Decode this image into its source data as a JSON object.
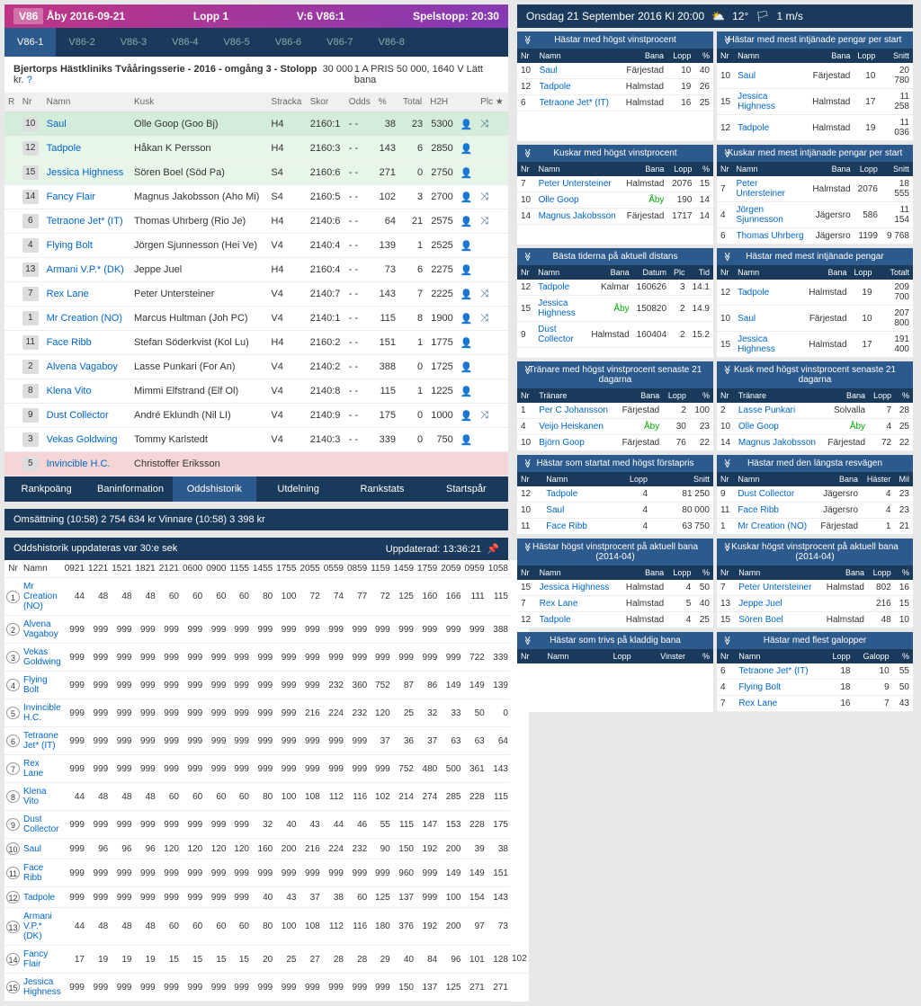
{
  "header": {
    "badge": "V86",
    "track": "Åby 2016-09-21",
    "race": "Lopp 1",
    "leg": "V:6 V86:1",
    "stop": "Spelstopp: 20:30"
  },
  "tabs": [
    "V86-1",
    "V86-2",
    "V86-3",
    "V86-4",
    "V86-5",
    "V86-6",
    "V86-7",
    "V86-8"
  ],
  "raceInfo": {
    "title": "Bjertorps Hästkliniks Tvååringsserie - 2016 - omgång 3 - Stolopp",
    "prize": "30 000 kr.",
    "cond": "1 A PRIS 50 000, 1640 V Lätt bana"
  },
  "mainCols": [
    "R",
    "Nr",
    "Namn",
    "Kusk",
    "Stracka",
    "Skor",
    "Odds",
    "%",
    "Total",
    "H2H",
    "",
    "Plc"
  ],
  "horses": [
    {
      "nr": "10",
      "name": "Saul",
      "kusk": "Olle Goop (Goo Bj)",
      "dist": "H4",
      "str": "2160:1",
      "sk": "- -",
      "odds": "38",
      "pct": "23",
      "tot": "5300",
      "ico": "👤",
      "x": "⤨",
      "hl": "hl-green"
    },
    {
      "nr": "12",
      "name": "Tadpole",
      "kusk": "Håkan K Persson",
      "dist": "H4",
      "str": "2160:3",
      "sk": "- -",
      "odds": "143",
      "pct": "6",
      "tot": "2850",
      "ico": "👤",
      "x": "",
      "hl": "hl-lgreen"
    },
    {
      "nr": "15",
      "name": "Jessica Highness",
      "kusk": "Sören Boel (Söd Pa)",
      "dist": "S4",
      "str": "2160:6",
      "sk": "- -",
      "odds": "271",
      "pct": "0",
      "tot": "2750",
      "ico": "👤",
      "x": "",
      "hl": "hl-lgreen"
    },
    {
      "nr": "14",
      "name": "Fancy Flair",
      "kusk": "Magnus Jakobsson (Aho Mi)",
      "dist": "S4",
      "str": "2160:5",
      "sk": "- -",
      "odds": "102",
      "pct": "3",
      "tot": "2700",
      "ico": "👤",
      "x": "⤨",
      "hl": ""
    },
    {
      "nr": "6",
      "name": "Tetraone Jet* (IT)",
      "kusk": "Thomas Uhrberg (Rio Je)",
      "dist": "H4",
      "str": "2140:6",
      "sk": "- -",
      "odds": "64",
      "pct": "21",
      "tot": "2575",
      "ico": "👤",
      "x": "⤨",
      "hl": ""
    },
    {
      "nr": "4",
      "name": "Flying Bolt",
      "kusk": "Jörgen Sjunnesson (Hei Ve)",
      "dist": "V4",
      "str": "2140:4",
      "sk": "- -",
      "odds": "139",
      "pct": "1",
      "tot": "2525",
      "ico": "👤",
      "x": "",
      "hl": ""
    },
    {
      "nr": "13",
      "name": "Armani V.P.* (DK)",
      "kusk": "Jeppe Juel",
      "dist": "H4",
      "str": "2160:4",
      "sk": "- -",
      "odds": "73",
      "pct": "6",
      "tot": "2275",
      "ico": "👤",
      "x": "",
      "hl": ""
    },
    {
      "nr": "7",
      "name": "Rex Lane",
      "kusk": "Peter Untersteiner",
      "dist": "V4",
      "str": "2140:7",
      "sk": "- -",
      "odds": "143",
      "pct": "7",
      "tot": "2225",
      "ico": "👤",
      "x": "⤨",
      "hl": ""
    },
    {
      "nr": "1",
      "name": "Mr Creation (NO)",
      "kusk": "Marcus Hultman (Joh PC)",
      "dist": "V4",
      "str": "2140:1",
      "sk": "- -",
      "odds": "115",
      "pct": "8",
      "tot": "1900",
      "ico": "👤",
      "x": "⤨",
      "hl": ""
    },
    {
      "nr": "11",
      "name": "Face Ribb",
      "kusk": "Stefan Söderkvist (Kol Lu)",
      "dist": "H4",
      "str": "2160:2",
      "sk": "- -",
      "odds": "151",
      "pct": "1",
      "tot": "1775",
      "ico": "👤",
      "x": "",
      "hl": ""
    },
    {
      "nr": "2",
      "name": "Alvena Vagaboy",
      "kusk": "Lasse Punkari (For An)",
      "dist": "V4",
      "str": "2140:2",
      "sk": "- -",
      "odds": "388",
      "pct": "0",
      "tot": "1725",
      "ico": "👤",
      "x": "",
      "hl": ""
    },
    {
      "nr": "8",
      "name": "Klena Vito",
      "kusk": "Mimmi Elfstrand (Elf Ol)",
      "dist": "V4",
      "str": "2140:8",
      "sk": "- -",
      "odds": "115",
      "pct": "1",
      "tot": "1225",
      "ico": "👤",
      "x": "",
      "hl": ""
    },
    {
      "nr": "9",
      "name": "Dust Collector",
      "kusk": "André Eklundh (Nil LI)",
      "dist": "V4",
      "str": "2140:9",
      "sk": "- -",
      "odds": "175",
      "pct": "0",
      "tot": "1000",
      "ico": "👤",
      "x": "⤨",
      "hl": ""
    },
    {
      "nr": "3",
      "name": "Vekas Goldwing",
      "kusk": "Tommy Karlstedt",
      "dist": "V4",
      "str": "2140:3",
      "sk": "- -",
      "odds": "339",
      "pct": "0",
      "tot": "750",
      "ico": "👤",
      "x": "",
      "hl": ""
    },
    {
      "nr": "5",
      "name": "Invincible H.C.",
      "kusk": "Christoffer Eriksson",
      "dist": "",
      "str": "",
      "sk": "",
      "odds": "",
      "pct": "",
      "tot": "",
      "ico": "",
      "x": "",
      "hl": "hl-pink"
    }
  ],
  "btns": [
    "Rankpoäng",
    "Baninformation",
    "Oddshistorik",
    "Utdelning",
    "Rankstats",
    "Startspår"
  ],
  "turnover": "Omsättning (10:58)   2 754 634 kr    Vinnare (10:58)   3 398 kr",
  "oddsHdr": {
    "l": "Oddshistorik uppdateras var 30:e sek",
    "r": "Uppdaterad: 13:36:21"
  },
  "oddsCols": [
    "Nr",
    "Namn",
    "0921",
    "1221",
    "1521",
    "1821",
    "2121",
    "0600",
    "0900",
    "1155",
    "1455",
    "1755",
    "2055",
    "0559",
    "0859",
    "1159",
    "1459",
    "1759",
    "2059",
    "0959",
    "1058"
  ],
  "odds": [
    {
      "nr": "1",
      "n": "Mr Creation (NO)",
      "v": [
        "44",
        "48",
        "48",
        "48",
        "60",
        "60",
        "60",
        "60",
        "80",
        "100",
        "72",
        "74",
        "77",
        "72",
        "125",
        "160",
        "166",
        "111",
        "115"
      ]
    },
    {
      "nr": "2",
      "n": "Alvena Vagaboy",
      "v": [
        "999",
        "999",
        "999",
        "999",
        "999",
        "999",
        "999",
        "999",
        "999",
        "999",
        "999",
        "999",
        "999",
        "999",
        "999",
        "999",
        "999",
        "999",
        "388"
      ]
    },
    {
      "nr": "3",
      "n": "Vekas Goldwing",
      "v": [
        "999",
        "999",
        "999",
        "999",
        "999",
        "999",
        "999",
        "999",
        "999",
        "999",
        "999",
        "999",
        "999",
        "999",
        "999",
        "999",
        "999",
        "722",
        "339"
      ]
    },
    {
      "nr": "4",
      "n": "Flying Bolt",
      "v": [
        "999",
        "999",
        "999",
        "999",
        "999",
        "999",
        "999",
        "999",
        "999",
        "999",
        "999",
        "232",
        "360",
        "752",
        "87",
        "86",
        "149",
        "149",
        "139"
      ]
    },
    {
      "nr": "5",
      "n": "Invincible H.C.",
      "v": [
        "999",
        "999",
        "999",
        "999",
        "999",
        "999",
        "999",
        "999",
        "999",
        "999",
        "216",
        "224",
        "232",
        "120",
        "25",
        "32",
        "33",
        "50",
        "0"
      ]
    },
    {
      "nr": "6",
      "n": "Tetraone Jet* (IT)",
      "v": [
        "999",
        "999",
        "999",
        "999",
        "999",
        "999",
        "999",
        "999",
        "999",
        "999",
        "999",
        "999",
        "999",
        "37",
        "36",
        "37",
        "63",
        "63",
        "64"
      ]
    },
    {
      "nr": "7",
      "n": "Rex Lane",
      "v": [
        "999",
        "999",
        "999",
        "999",
        "999",
        "999",
        "999",
        "999",
        "999",
        "999",
        "999",
        "999",
        "999",
        "999",
        "752",
        "480",
        "500",
        "361",
        "143"
      ]
    },
    {
      "nr": "8",
      "n": "Klena Vito",
      "v": [
        "44",
        "48",
        "48",
        "48",
        "60",
        "60",
        "60",
        "60",
        "80",
        "100",
        "108",
        "112",
        "116",
        "102",
        "214",
        "274",
        "285",
        "228",
        "115"
      ]
    },
    {
      "nr": "9",
      "n": "Dust Collector",
      "v": [
        "999",
        "999",
        "999",
        "999",
        "999",
        "999",
        "999",
        "999",
        "32",
        "40",
        "43",
        "44",
        "46",
        "55",
        "115",
        "147",
        "153",
        "228",
        "175"
      ]
    },
    {
      "nr": "10",
      "n": "Saul",
      "v": [
        "999",
        "96",
        "96",
        "96",
        "120",
        "120",
        "120",
        "120",
        "160",
        "200",
        "216",
        "224",
        "232",
        "90",
        "150",
        "192",
        "200",
        "39",
        "38"
      ]
    },
    {
      "nr": "11",
      "n": "Face Ribb",
      "v": [
        "999",
        "999",
        "999",
        "999",
        "999",
        "999",
        "999",
        "999",
        "999",
        "999",
        "999",
        "999",
        "999",
        "999",
        "960",
        "999",
        "149",
        "149",
        "151"
      ]
    },
    {
      "nr": "12",
      "n": "Tadpole",
      "v": [
        "999",
        "999",
        "999",
        "999",
        "999",
        "999",
        "999",
        "999",
        "40",
        "43",
        "37",
        "38",
        "60",
        "125",
        "137",
        "999",
        "100",
        "154",
        "143"
      ]
    },
    {
      "nr": "13",
      "n": "Armani V.P.* (DK)",
      "v": [
        "44",
        "48",
        "48",
        "48",
        "60",
        "60",
        "60",
        "60",
        "80",
        "100",
        "108",
        "112",
        "116",
        "180",
        "376",
        "192",
        "200",
        "97",
        "73"
      ]
    },
    {
      "nr": "14",
      "n": "Fancy Flair",
      "v": [
        "17",
        "19",
        "19",
        "19",
        "15",
        "15",
        "15",
        "15",
        "20",
        "25",
        "27",
        "28",
        "28",
        "29",
        "40",
        "84",
        "96",
        "101",
        "128",
        "102"
      ]
    },
    {
      "nr": "15",
      "n": "Jessica Highness",
      "v": [
        "999",
        "999",
        "999",
        "999",
        "999",
        "999",
        "999",
        "999",
        "999",
        "999",
        "999",
        "999",
        "999",
        "999",
        "150",
        "137",
        "125",
        "271",
        "271"
      ]
    }
  ],
  "weather": {
    "d": "Onsdag 21 September 2016 Kl 20:00",
    "t": "12°",
    "w": "1 m/s"
  },
  "stats": [
    {
      "t": "Hästar med högst vinstprocent",
      "c": [
        "Nr",
        "Namn",
        "Bana",
        "Lopp",
        "%"
      ],
      "r": [
        [
          "10",
          "Saul",
          "Färjestad",
          "10",
          "40"
        ],
        [
          "12",
          "Tadpole",
          "Halmstad",
          "19",
          "26"
        ],
        [
          "6",
          "Tetraone Jet* (IT)",
          "Halmstad",
          "16",
          "25"
        ]
      ]
    },
    {
      "t": "Hästar med mest intjänade pengar per start",
      "c": [
        "Nr",
        "Namn",
        "Bana",
        "Lopp",
        "Snitt"
      ],
      "r": [
        [
          "10",
          "Saul",
          "Färjestad",
          "10",
          "20 780"
        ],
        [
          "15",
          "Jessica Highness",
          "Halmstad",
          "17",
          "11 258"
        ],
        [
          "12",
          "Tadpole",
          "Halmstad",
          "19",
          "11 036"
        ]
      ]
    },
    {
      "t": "Kuskar med högst vinstprocent",
      "c": [
        "Nr",
        "Namn",
        "Bana",
        "Lopp",
        "%"
      ],
      "r": [
        [
          "7",
          "Peter Untersteiner",
          "Halmstad",
          "2076",
          "15"
        ],
        [
          "10",
          "Olle Goop",
          "Åby",
          "190",
          "14"
        ],
        [
          "14",
          "Magnus Jakobsson",
          "Färjestad",
          "1717",
          "14"
        ]
      ],
      "gr": [
        1
      ]
    },
    {
      "t": "Kuskar med mest intjänade pengar per start",
      "c": [
        "Nr",
        "Namn",
        "Bana",
        "Lopp",
        "Snitt"
      ],
      "r": [
        [
          "7",
          "Peter Untersteiner",
          "Halmstad",
          "2076",
          "18 555"
        ],
        [
          "4",
          "Jörgen Sjunnesson",
          "Jägersro",
          "586",
          "11 154"
        ],
        [
          "6",
          "Thomas Uhrberg",
          "Jägersro",
          "1199",
          "9 768"
        ]
      ]
    },
    {
      "t": "Bästa tiderna på aktuell distans",
      "c": [
        "Nr",
        "Namn",
        "Bana",
        "Datum",
        "Plc",
        "Tid"
      ],
      "r": [
        [
          "12",
          "Tadpole",
          "Kalmar",
          "160626",
          "3",
          "14.1"
        ],
        [
          "15",
          "Jessica Highness",
          "Åby",
          "150820",
          "2",
          "14.9"
        ],
        [
          "9",
          "Dust Collector",
          "Halmstad",
          "160404",
          "2",
          "15.2"
        ]
      ],
      "gr": [
        1
      ]
    },
    {
      "t": "Hästar med mest intjänade pengar",
      "c": [
        "Nr",
        "Namn",
        "Bana",
        "Lopp",
        "Totalt"
      ],
      "r": [
        [
          "12",
          "Tadpole",
          "Halmstad",
          "19",
          "209 700"
        ],
        [
          "10",
          "Saul",
          "Färjestad",
          "10",
          "207 800"
        ],
        [
          "15",
          "Jessica Highness",
          "Halmstad",
          "17",
          "191 400"
        ]
      ]
    },
    {
      "t": "Tränare med högst vinstprocent senaste 21 dagarna",
      "c": [
        "Nr",
        "Tränare",
        "Bana",
        "Lopp",
        "%"
      ],
      "r": [
        [
          "1",
          "Per C Johansson",
          "Färjestad",
          "2",
          "100"
        ],
        [
          "4",
          "Veijo Heiskanen",
          "Åby",
          "30",
          "23"
        ],
        [
          "10",
          "Björn Goop",
          "Färjestad",
          "76",
          "22"
        ]
      ],
      "gr": [
        1
      ]
    },
    {
      "t": "Kusk med högst vinstprocent senaste 21 dagarna",
      "c": [
        "Nr",
        "Tränare",
        "Bana",
        "Lopp",
        "%"
      ],
      "r": [
        [
          "2",
          "Lasse Punkari",
          "Solvalla",
          "7",
          "28"
        ],
        [
          "10",
          "Olle Goop",
          "Åby",
          "4",
          "25"
        ],
        [
          "14",
          "Magnus Jakobsson",
          "Färjestad",
          "72",
          "22"
        ]
      ],
      "gr": [
        1
      ]
    },
    {
      "t": "Hästar som startat med högst förstapris",
      "c": [
        "Nr",
        "Namn",
        "Lopp",
        "",
        "Snitt"
      ],
      "r": [
        [
          "12",
          "Tadpole",
          "4",
          "",
          "81 250"
        ],
        [
          "10",
          "Saul",
          "4",
          "",
          "80 000"
        ],
        [
          "11",
          "Face Ribb",
          "4",
          "",
          "63 750"
        ]
      ]
    },
    {
      "t": "Hästar med den längsta resvägen",
      "c": [
        "Nr",
        "Namn",
        "Bana",
        "Häster",
        "Mil"
      ],
      "r": [
        [
          "9",
          "Dust Collector",
          "Jägersro",
          "4",
          "23"
        ],
        [
          "11",
          "Face Ribb",
          "Jägersro",
          "4",
          "23"
        ],
        [
          "1",
          "Mr Creation (NO)",
          "Färjestad",
          "1",
          "21"
        ]
      ]
    },
    {
      "t": "Hästar högst vinstprocent på aktuell bana (2014-04)",
      "c": [
        "Nr",
        "Namn",
        "Bana",
        "Lopp",
        "%"
      ],
      "r": [
        [
          "15",
          "Jessica Highness",
          "Halmstad",
          "4",
          "50"
        ],
        [
          "7",
          "Rex Lane",
          "Halmstad",
          "5",
          "40"
        ],
        [
          "12",
          "Tadpole",
          "Halmstad",
          "4",
          "25"
        ]
      ]
    },
    {
      "t": "Kuskar högst vinstprocent på aktuell bana (2014-04)",
      "c": [
        "Nr",
        "Namn",
        "Bana",
        "Lopp",
        "%"
      ],
      "r": [
        [
          "7",
          "Peter Untersteiner",
          "Halmstad",
          "802",
          "16"
        ],
        [
          "13",
          "Jeppe Juel",
          "",
          "216",
          "15"
        ],
        [
          "15",
          "Sören Boel",
          "Halmstad",
          "48",
          "10"
        ]
      ]
    },
    {
      "t": "Hästar som trivs på kladdig bana",
      "c": [
        "Nr",
        "Namn",
        "Lopp",
        "Vinster",
        "%"
      ],
      "r": []
    },
    {
      "t": "Hästar med flest galopper",
      "c": [
        "Nr",
        "Namn",
        "Lopp",
        "Galopp",
        "%"
      ],
      "r": [
        [
          "6",
          "Tetraone Jet* (IT)",
          "18",
          "10",
          "55"
        ],
        [
          "4",
          "Flying Bolt",
          "18",
          "9",
          "50"
        ],
        [
          "7",
          "Rex Lane",
          "16",
          "7",
          "43"
        ]
      ]
    }
  ]
}
